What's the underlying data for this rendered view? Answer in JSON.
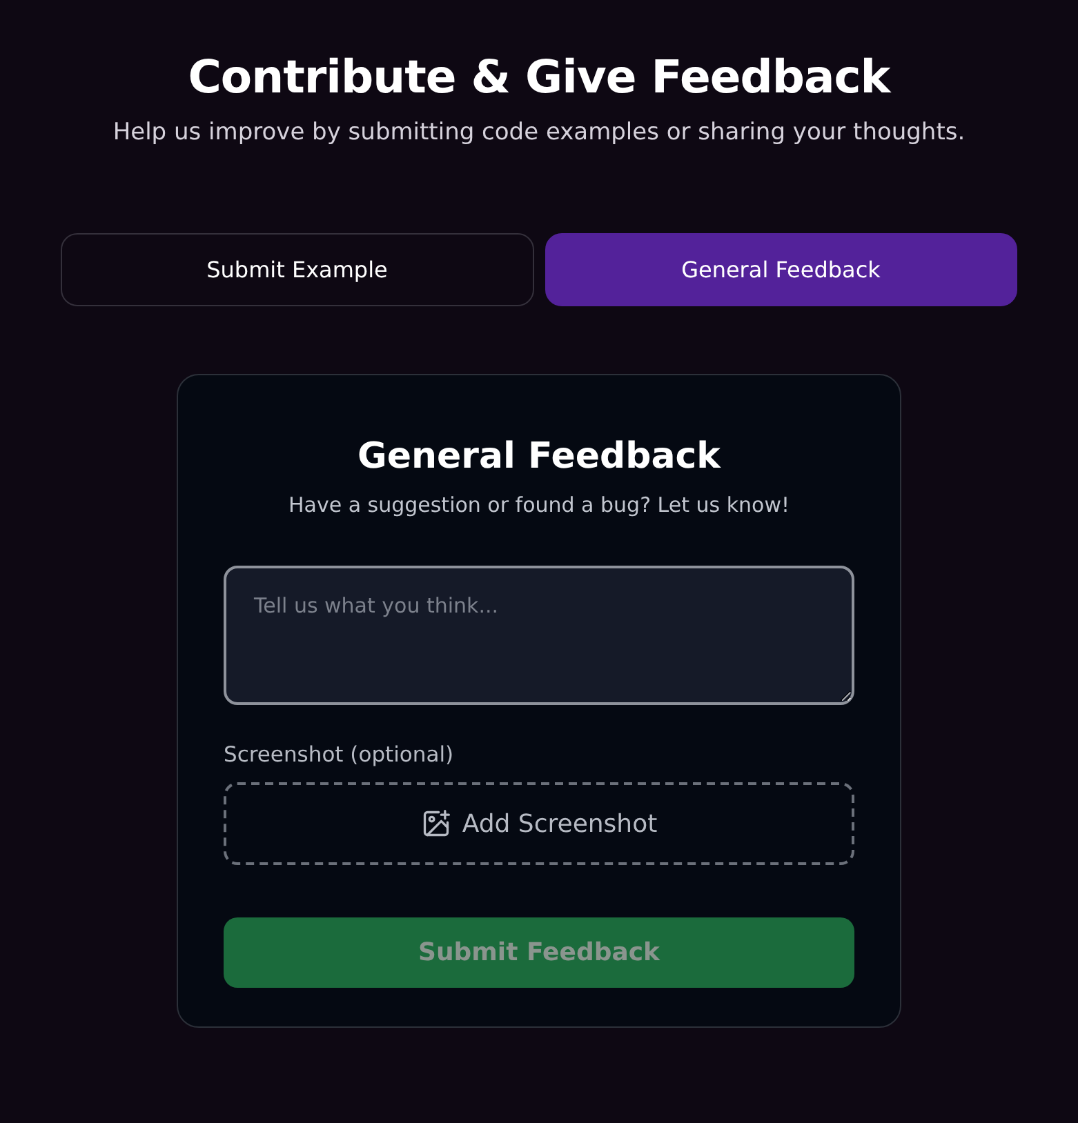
{
  "header": {
    "title": "Contribute & Give Feedback",
    "subtitle": "Help us improve by submitting code examples or sharing your thoughts."
  },
  "tabs": [
    {
      "label": "Submit Example",
      "selected": false
    },
    {
      "label": "General Feedback",
      "selected": true
    }
  ],
  "form": {
    "title": "General Feedback",
    "subtitle": "Have a suggestion or found a bug? Let us know!",
    "message": {
      "placeholder": "Tell us what you think..."
    },
    "screenshot_label": "Screenshot (optional)",
    "add_screenshot": "Add Screenshot",
    "submit": {
      "label": "Submit Feedback",
      "disabled": true
    }
  }
}
